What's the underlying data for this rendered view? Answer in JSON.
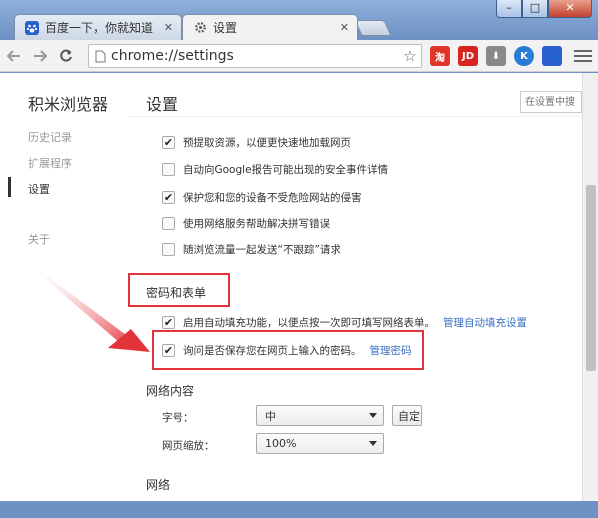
{
  "window": {
    "minimize_symbol": "–",
    "maximize_symbol": "□",
    "close_symbol": "✕"
  },
  "tabs": [
    {
      "title": "百度一下，你就知道",
      "close": "✕",
      "icon": "paw-icon"
    },
    {
      "title": "设置",
      "close": "✕",
      "icon": "gear-icon"
    }
  ],
  "toolbar": {
    "url": "chrome://settings",
    "star": "☆",
    "extensions": [
      {
        "name": "淘",
        "color": "#e0352b"
      },
      {
        "name": "JD",
        "color": "#d8231f"
      },
      {
        "name": "⬇",
        "color": "#888888"
      },
      {
        "name": "K",
        "color": "#2a7bd6"
      },
      {
        "name": "🐾",
        "color": "#2a5fd0"
      }
    ]
  },
  "sidebar": {
    "app_title": "积米浏览器",
    "items": [
      {
        "label": "历史记录"
      },
      {
        "label": "扩展程序"
      },
      {
        "label": "设置",
        "selected": true
      },
      {
        "label": "关于"
      }
    ]
  },
  "header": {
    "title": "设置",
    "search_placeholder": "在设置中搜"
  },
  "privacy_rows": [
    {
      "label": "预提取资源，以便更快速地加载网页",
      "checked": true
    },
    {
      "label": "自动向Google报告可能出现的安全事件详情",
      "checked": false
    },
    {
      "label": "保护您和您的设备不受危险网站的侵害",
      "checked": true
    },
    {
      "label": "使用网络服务帮助解决拼写错误",
      "checked": false
    },
    {
      "label": "随浏览流量一起发送“不跟踪”请求",
      "checked": false
    }
  ],
  "passwords": {
    "section_title": "密码和表单",
    "autofill": {
      "label": "启用自动填充功能，以便点按一次即可填写网络表单。",
      "link": "管理自动填充设置",
      "checked": true
    },
    "save_passwords": {
      "label": "询问是否保存您在网页上输入的密码。",
      "link": "管理密码",
      "checked": true
    }
  },
  "web_content": {
    "section_title": "网络内容",
    "font_size_label": "字号：",
    "font_size_value": "中",
    "customize_fonts_button": "自定",
    "zoom_label": "网页缩放：",
    "zoom_value": "100%"
  },
  "network": {
    "section_title": "网络"
  },
  "colors": {
    "annotation": "#e2333b",
    "link": "#3a6fc2"
  }
}
